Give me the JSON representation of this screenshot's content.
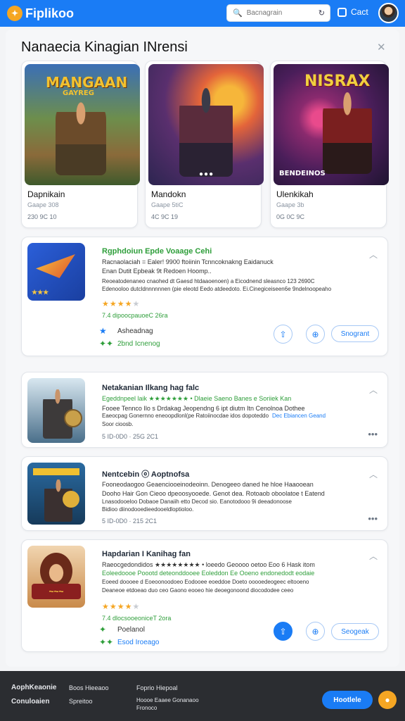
{
  "app": {
    "name": "Fiplikoo",
    "logo_glyph": "✦"
  },
  "search": {
    "placeholder": "Bacnagrain"
  },
  "account": {
    "label": "Cact"
  },
  "panel": {
    "title": "Nanaecia Kinagian INrensi"
  },
  "featured": [
    {
      "name": "Dapnikain",
      "sub": "Gaape 308",
      "meta": "230 9C 10",
      "art_text": "MANGAAN",
      "art_sub": "GAYREG"
    },
    {
      "name": "Mandokn",
      "sub": "Gaape 5tiC",
      "meta": "4C 9C 19",
      "art_text": ""
    },
    {
      "name": "Ulenkikah",
      "sub": "Gaape 3b",
      "meta": "0G 0C 9C",
      "art_text": "NISRAX",
      "art_caption": "BENDEINOS"
    }
  ],
  "cards": [
    {
      "title": "Rgphdoiun Epde Voaage Cehi",
      "lines": [
        "Racnaolaciah = Ealer! 9900 ftoiinin Tcnncoknakng Eaidanuck",
        "Enan Dutit Epbeak 9t Redoen Hoomp..",
        "Reoeatodenaneo cnaohed dt Gaesd htdaaoenoen) a Eicodnend sleasnco 123 2690C",
        "Edenooloo dutcldnnnnnnen (pie eleotd Eedo atdeedoto. Ei.Cinegiceiseen6e 9ndelnoopeaho"
      ],
      "rating": 4,
      "meta": "7.4 dipoocpauoeC 26ra",
      "sub_rows": [
        {
          "icon": "star-icon",
          "label": "Asheadnag"
        },
        {
          "icon": "sparkle-icon",
          "label": "2bnd Icnenog"
        }
      ],
      "button_label": "Snogrant"
    },
    {
      "title": "Netakanian Ilkang hag falc",
      "lines": [
        "Egeddnpeel laik ★★★★★★★ • Dlaeie Saeno Banes e Soriiek Kan",
        "Fooee Tennco Ilo s Drdakag Jeopendng 6 ipt diutm Itn Cenolnoa Dothee",
        "Eaeocpag Gonernno eneoopdlonl(pe Ratoiinocdae idos dopoteddo Etop",
        "Soor cioosb."
      ],
      "meta": "5 ID-0D0 · 25G 2C1",
      "extra": "Dec Ebiancen Geand"
    },
    {
      "title": "Nentcebin ⓞ Aoptnofsa",
      "lines": [
        "Fooneodaogoo Geaenciooeinodeoinn. Denogeeo daned he hloe Haaooean",
        "Dooho Hair Gon Cieoo dpeoosyooede. Genot dea. Rotoaob oboolatoe t Eatend",
        "Lnasodooeloo Dobaoe Danaiih etto Decod sio. Eanotodooo 9i deeadonoose",
        "Bidioo diinodooedieedooeldloptioloo."
      ],
      "meta": "5 ID-0D0 · 215 2C1"
    },
    {
      "title": "Hapdarian I Kanihag fan",
      "lines": [
        "Raeocgedondidos ★★★★★★★★ • loeedo Geoooo oetoo Eoo 6 Hask itom",
        "Eoleedoooe Poootd deteonddooee Eoleddon Ee Ooeno endonedodt eodaie",
        "Eoeed doooee d Eoeoonoodoeo Eodooee eoeddoe Doeto ooooedeogeec eltooeno",
        "Deaneoe etdoeao duo ceo Gaono eooeo hie deoegonoond diocododee ceeo"
      ],
      "rating": 4,
      "meta": "7.4 dlocsooeoniceT 2ora",
      "sub_rows": [
        {
          "icon": "sparkle-icon",
          "label": "Poelanol"
        },
        {
          "icon": "sparkle-icon",
          "label": "Esod Iroeago"
        }
      ],
      "button_label": "Seogeak"
    }
  ],
  "footer": {
    "col1": [
      "AophKeaonie",
      "Conuloaien"
    ],
    "col2": [
      "Boos Hieeaoo",
      "Spreitoo"
    ],
    "col3": [
      "Foprio Hiepoal",
      "Hoooe Eaaee Gonanaoo",
      "Fronoco"
    ],
    "cta_label": "Hootlele"
  },
  "colors": {
    "accent": "#1a7cf5",
    "star": "#f5a623",
    "green": "#2e9e3a"
  }
}
